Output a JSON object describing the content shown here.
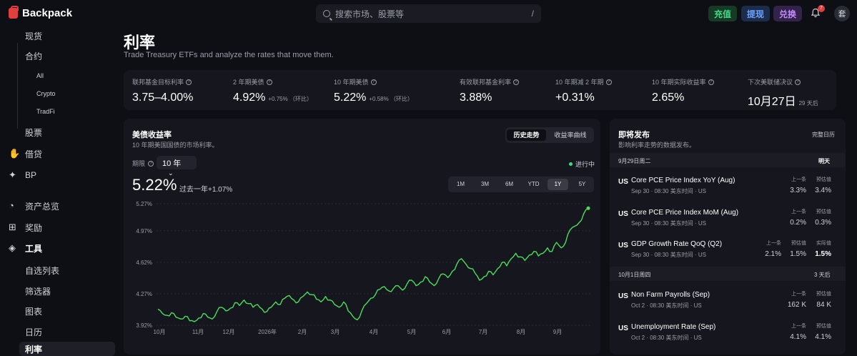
{
  "header": {
    "brand": "Backpack",
    "search_placeholder": "搜索市场、股票等",
    "search_shortcut": "/",
    "deposit": "充值",
    "withdraw": "提现",
    "swap": "兑换",
    "notif_count": "7",
    "avatar_initial": "套"
  },
  "sidebar": {
    "spot": "现货",
    "futures": "合约",
    "sub_all": "All",
    "sub_crypto": "Crypto",
    "sub_tradfi": "TradFi",
    "stocks": "股票",
    "lending": "借贷",
    "bp": "BP",
    "portfolio": "资产总览",
    "rewards": "奖励",
    "tools": "工具",
    "watchlist": "自选列表",
    "screener": "筛选器",
    "charts": "图表",
    "calendar": "日历",
    "rates": "利率"
  },
  "page": {
    "title": "利率",
    "subtitle": "Trade Treasury ETFs and analyze the rates that move them."
  },
  "stats": [
    {
      "label": "联邦基金目标利率",
      "value": "3.75–4.00%",
      "note": ""
    },
    {
      "label": "2 年期美债",
      "value": "4.92%",
      "note": "+0.75% （环比）"
    },
    {
      "label": "10 年期美债",
      "value": "5.22%",
      "note": "+0.58% （环比）"
    },
    {
      "label": "有效联邦基金利率",
      "value": "3.88%",
      "note": ""
    },
    {
      "label": "10 年期减 2 年期",
      "value": "+0.31%",
      "note": ""
    },
    {
      "label": "10 年期实际收益率",
      "value": "2.65%",
      "note": ""
    },
    {
      "label": "下次美联储决议",
      "value": "10月27日",
      "note": "29 天后"
    }
  ],
  "chart_card": {
    "title": "美债收益率",
    "subtitle": "10 年期美国国债的市场利率。",
    "tab_history": "历史走势",
    "tab_curve": "收益率曲线",
    "period_label": "期限",
    "period_value": "10 年",
    "live_label": "进行中",
    "current_value": "5.22%",
    "change_text": "过去一年+1.07%",
    "ranges": [
      "1M",
      "3M",
      "6M",
      "YTD",
      "1Y",
      "5Y"
    ],
    "active_range": "1Y",
    "line_color": "#4ade5a"
  },
  "chart_data": {
    "type": "line",
    "title": "",
    "xlabel": "",
    "ylabel": "",
    "x_ticks": [
      "10月",
      "11月",
      "12月",
      "2026年",
      "2月",
      "3月",
      "4月",
      "5月",
      "6月",
      "7月",
      "8月",
      "9月"
    ],
    "y_ticks": [
      "5.27%",
      "4.97%",
      "4.62%",
      "4.27%",
      "3.92%"
    ],
    "ylim": [
      3.92,
      5.27
    ],
    "grid": true,
    "series": [
      {
        "values": [
          4.1,
          4.05,
          4.03,
          4.06,
          4.01,
          3.99,
          4.02,
          3.97,
          3.96,
          4.0,
          4.05,
          4.01,
          3.99,
          4.07,
          4.12,
          4.08,
          4.11,
          4.17,
          4.14,
          4.2,
          4.16,
          4.12,
          4.15,
          4.1,
          4.07,
          4.12,
          4.18,
          4.15,
          4.22,
          4.25,
          4.2,
          4.18,
          4.24,
          4.29,
          4.26,
          4.21,
          4.18,
          4.24,
          4.2,
          4.15,
          4.12,
          4.18,
          4.08,
          4.02,
          3.98,
          4.08,
          4.16,
          4.22,
          4.26,
          4.32,
          4.35,
          4.3,
          4.33,
          4.36,
          4.31,
          4.38,
          4.42,
          4.36,
          4.4,
          4.46,
          4.4,
          4.36,
          4.44,
          4.49,
          4.45,
          4.52,
          4.6,
          4.66,
          4.6,
          4.55,
          4.5,
          4.42,
          4.46,
          4.52,
          4.48,
          4.55,
          4.62,
          4.58,
          4.66,
          4.72,
          4.68,
          4.64,
          4.7,
          4.74,
          4.69,
          4.72,
          4.78,
          4.74,
          4.84,
          4.78,
          4.84,
          4.98,
          5.02,
          5.06,
          5.16,
          5.22
        ]
      }
    ]
  },
  "releases": {
    "title": "即将发布",
    "subtitle": "影响利率走势的数据发布。",
    "full_calendar": "完整日历",
    "groups": [
      {
        "date": "9月29日周二",
        "tag": "明天",
        "events": [
          {
            "cc": "US",
            "name": "Core PCE Price Index YoY (Aug)",
            "meta": "Sep 30 · 08:30 美东时间 · US",
            "h1": "上一条",
            "v1": "3.3%",
            "h2": "预估值",
            "v2": "3.4%"
          },
          {
            "cc": "US",
            "name": "Core PCE Price Index MoM (Aug)",
            "meta": "Sep 30 · 08:30 美东时间 · US",
            "h1": "上一条",
            "v1": "0.2%",
            "h2": "预估值",
            "v2": "0.3%"
          },
          {
            "cc": "US",
            "name": "GDP Growth Rate QoQ (Q2)",
            "meta": "Sep 30 · 08:30 美东时间 · US",
            "h0": "上一条",
            "v0": "2.1%",
            "h1": "预估值",
            "v1": "1.5%",
            "h2": "实际值",
            "v2": "1.5%"
          }
        ]
      },
      {
        "date": "10月1日周四",
        "tag": "3 天后",
        "events": [
          {
            "cc": "US",
            "name": "Non Farm Payrolls (Sep)",
            "meta": "Oct 2 · 08:30 美东时间 · US",
            "h1": "上一条",
            "v1": "162 K",
            "h2": "预估值",
            "v2": "84 K"
          },
          {
            "cc": "US",
            "name": "Unemployment Rate (Sep)",
            "meta": "Oct 2 · 08:30 美东时间 · US",
            "h1": "上一条",
            "v1": "4.1%",
            "h2": "预估值",
            "v2": "4.1%"
          }
        ]
      }
    ]
  }
}
